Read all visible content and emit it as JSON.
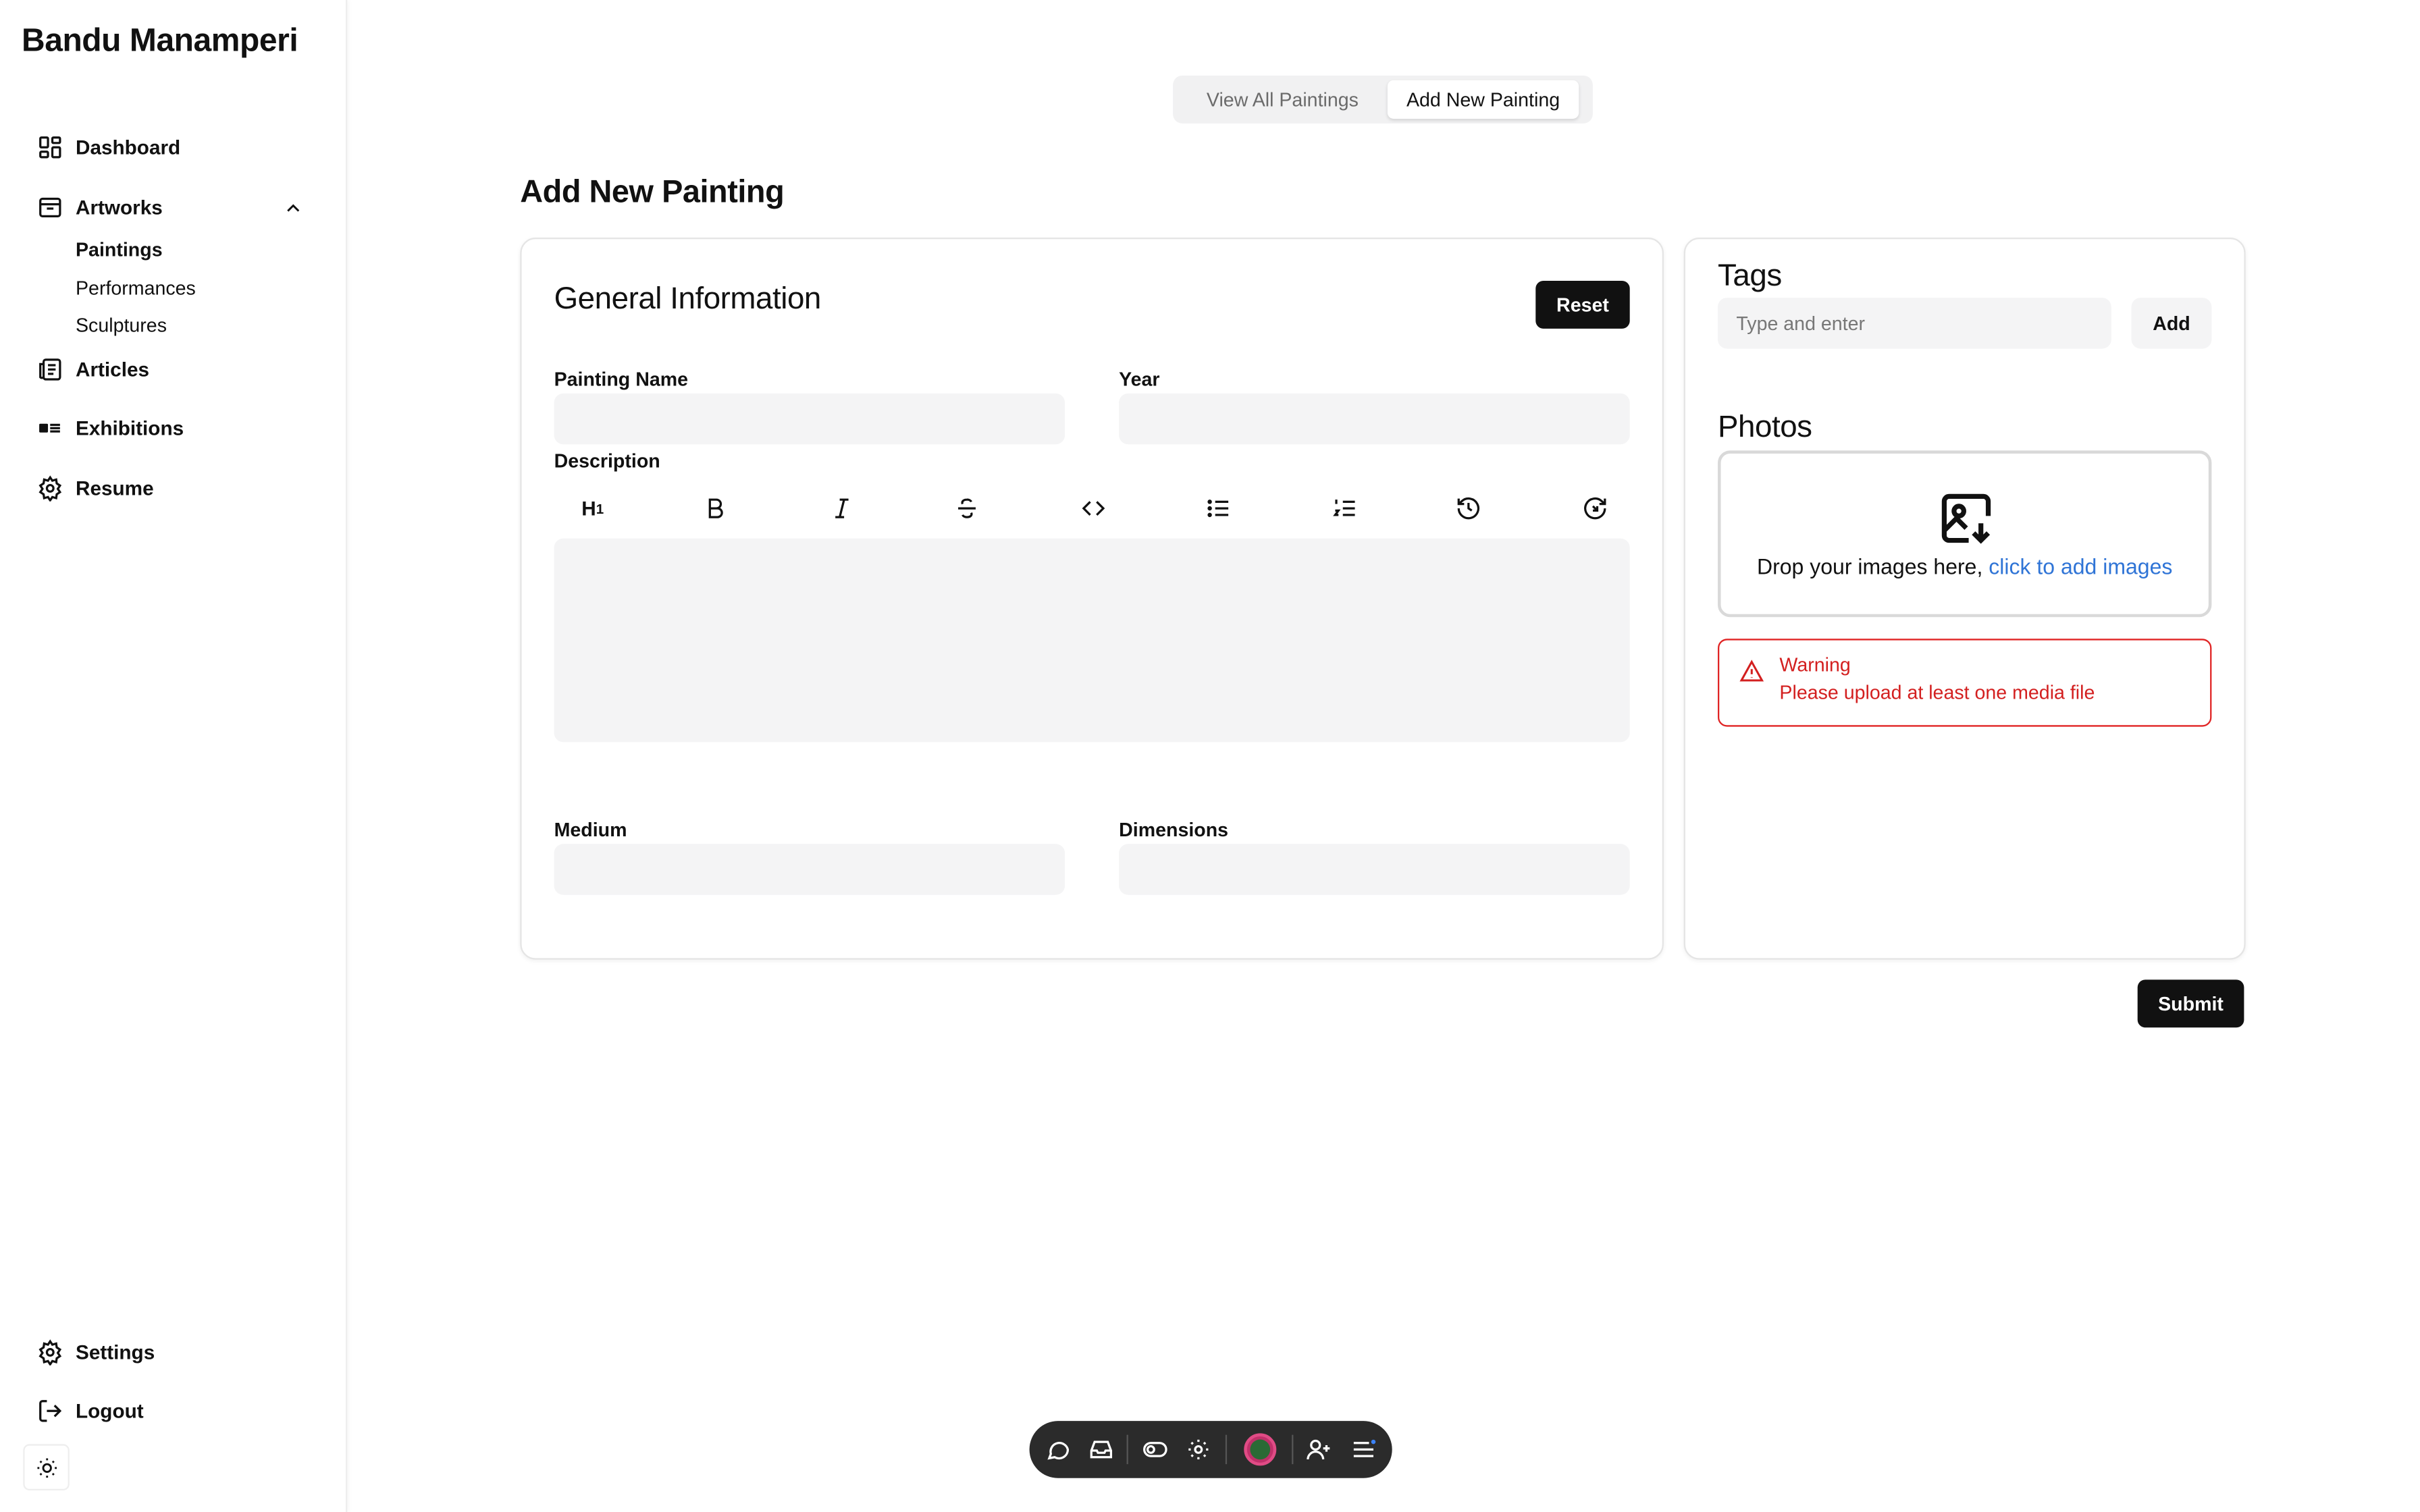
{
  "sidebar": {
    "brand": "Bandu Manamperi",
    "nav": {
      "dashboard": "Dashboard",
      "artworks": "Artworks",
      "articles": "Articles",
      "exhibitions": "Exhibitions",
      "resume": "Resume",
      "settings": "Settings",
      "logout": "Logout"
    },
    "artworks_sub": [
      "Paintings",
      "Performances",
      "Sculptures"
    ]
  },
  "tabs": {
    "view_all": "View All Paintings",
    "add_new": "Add New Painting",
    "active": "add_new"
  },
  "page_title": "Add New Painting",
  "general": {
    "title": "General Information",
    "reset_label": "Reset",
    "fields": {
      "painting_name": {
        "label": "Painting Name",
        "value": ""
      },
      "year": {
        "label": "Year",
        "value": ""
      },
      "description": {
        "label": "Description",
        "value": ""
      },
      "medium": {
        "label": "Medium",
        "value": ""
      },
      "dimensions": {
        "label": "Dimensions",
        "value": ""
      }
    },
    "toolbar": [
      "heading-1-icon",
      "bold-icon",
      "italic-icon",
      "strikethrough-icon",
      "code-icon",
      "bullet-list-icon",
      "ordered-list-icon",
      "undo-history-icon",
      "redo-history-icon"
    ]
  },
  "tags": {
    "title": "Tags",
    "placeholder": "Type and enter",
    "add_label": "Add"
  },
  "photos": {
    "title": "Photos",
    "drop_text": "Drop your images here,",
    "drop_link": "click to add images"
  },
  "warning": {
    "title": "Warning",
    "message": "Please upload at least one media file",
    "color": "#e02424"
  },
  "submit_label": "Submit",
  "dock": [
    "chat-icon",
    "inbox-icon",
    "toggle-icon",
    "settings-cog-icon",
    "user-avatar",
    "add-user-icon",
    "menu-icon"
  ]
}
